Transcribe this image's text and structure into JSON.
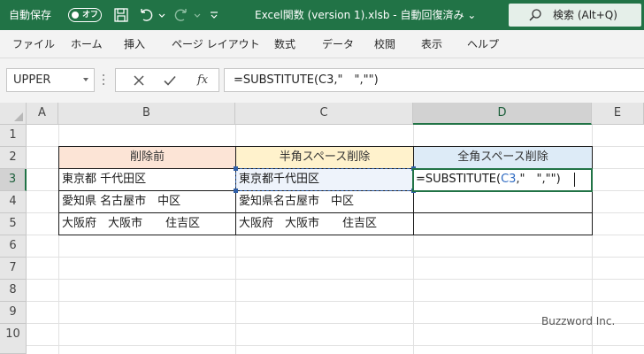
{
  "titlebar": {
    "autosave_label": "自動保存",
    "autosave_toggle": "オフ",
    "title": "Excel関数 (version 1).xlsb  -  自動回復済み  ⌄",
    "search_label": "検索 (Alt+Q)",
    "background": "#217346"
  },
  "ribbon": {
    "tabs": [
      "ファイル",
      "ホーム",
      "挿入",
      "ページ レイアウト",
      "数式",
      "データ",
      "校閲",
      "表示",
      "ヘルプ"
    ]
  },
  "formula_bar": {
    "name_box": "UPPER",
    "fx_symbol": "fx",
    "formula": "=SUBSTITUTE(C3,\"　\",\"\")"
  },
  "grid": {
    "columns": [
      "A",
      "B",
      "C",
      "D",
      "E"
    ],
    "rows": [
      "1",
      "2",
      "3",
      "4",
      "5",
      "6",
      "7",
      "8",
      "9",
      "10"
    ],
    "active_column": "D",
    "active_row": "3",
    "table": {
      "headers": [
        "削除前",
        "半角スペース削除",
        "全角スペース削除"
      ],
      "header_colors": [
        "#fce4d6",
        "#fff2cc",
        "#ddebf7"
      ],
      "rows": [
        [
          "東京都 千代田区",
          "東京都千代田区",
          ""
        ],
        [
          "愛知県 名古屋市　中区",
          "愛知県名古屋市　中区",
          ""
        ],
        [
          "大阪府　大阪市　　住吉区",
          "大阪府　大阪市　　住吉区",
          ""
        ]
      ]
    },
    "editing_cell": {
      "prefix": "=SUBSTITUTE(",
      "ref": "C3",
      "suffix": ",\"　\",\"\")"
    }
  },
  "watermark": "Buzzword Inc."
}
